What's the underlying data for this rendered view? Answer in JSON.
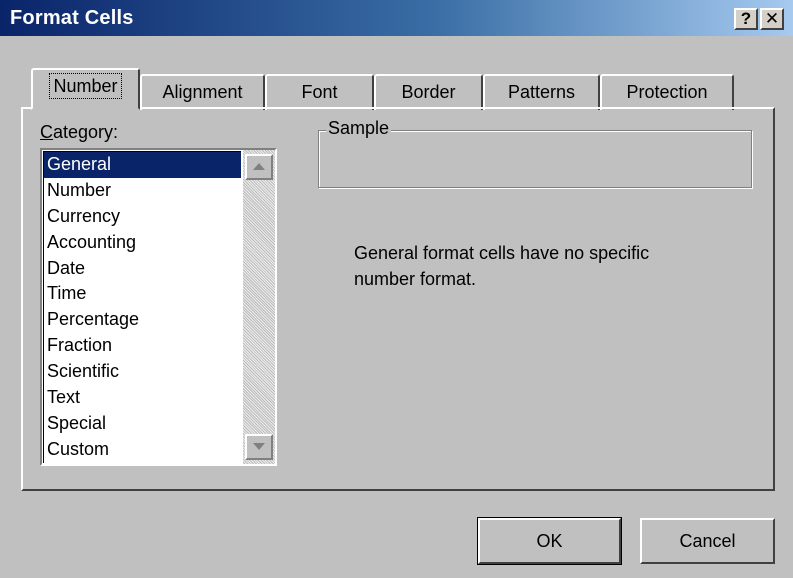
{
  "window": {
    "title": "Format Cells",
    "help_glyph": "?",
    "close_glyph": "✕"
  },
  "tabs": [
    {
      "label": "Number",
      "active": true
    },
    {
      "label": "Alignment",
      "active": false
    },
    {
      "label": "Font",
      "active": false
    },
    {
      "label": "Border",
      "active": false
    },
    {
      "label": "Patterns",
      "active": false
    },
    {
      "label": "Protection",
      "active": false
    }
  ],
  "category": {
    "label_accel": "C",
    "label_rest": "ategory:",
    "items": [
      "General",
      "Number",
      "Currency",
      "Accounting",
      "Date",
      "Time",
      "Percentage",
      "Fraction",
      "Scientific",
      "Text",
      "Special",
      "Custom"
    ],
    "selected": "General"
  },
  "sample": {
    "label": "Sample",
    "value": ""
  },
  "description": "General format cells have no specific number format.",
  "buttons": {
    "ok": "OK",
    "cancel": "Cancel"
  },
  "colors": {
    "title_bar": "#0a246a",
    "selection": "#0a246a",
    "face": "#c0c0c0"
  }
}
